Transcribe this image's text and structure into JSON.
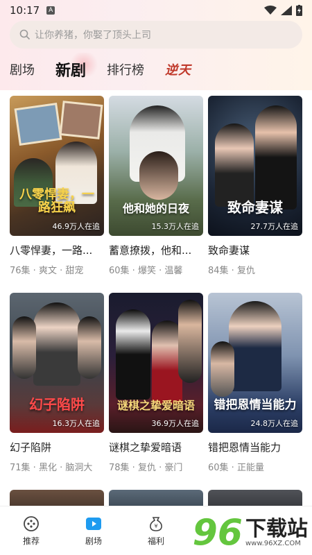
{
  "status": {
    "time": "10:17"
  },
  "search": {
    "placeholder": "让你养猪，你娶了顶头上司"
  },
  "tabs": {
    "t1": "剧场",
    "t2": "新剧",
    "t3": "排行榜",
    "t4": "逆天"
  },
  "cards": [
    {
      "poster_title": "八零悍妻，一路狂飙",
      "watch": "46.9万人在追",
      "title": "八零悍妻，一路...",
      "meta": "76集 · 爽文 · 甜宠"
    },
    {
      "poster_title": "他和她的日夜",
      "watch": "15.3万人在追",
      "title": "蓄意撩拨，他和...",
      "meta": "60集 · 爆笑 · 温馨"
    },
    {
      "poster_title": "致命妻谋",
      "watch": "27.7万人在追",
      "title": "致命妻谋",
      "meta": "84集 · 复仇"
    },
    {
      "poster_title": "幻子陷阱",
      "watch": "16.3万人在追",
      "title": "幻子陷阱",
      "meta": "71集 · 黑化 · 脑洞大"
    },
    {
      "poster_title": "谜棋之挚爱暗语",
      "watch": "36.9万人在追",
      "title": "谜棋之挚爱暗语",
      "meta": "78集 · 复仇 · 豪门"
    },
    {
      "poster_title": "错把恩情当能力",
      "watch": "24.8万人在追",
      "title": "错把恩情当能力",
      "meta": "60集 · 正能量"
    }
  ],
  "tabbar": {
    "recommend": "推荐",
    "theater": "剧场",
    "welfare": "福利"
  },
  "watermark": {
    "num": "96",
    "cn": "下载站",
    "url": "www.96XZ.COM"
  }
}
